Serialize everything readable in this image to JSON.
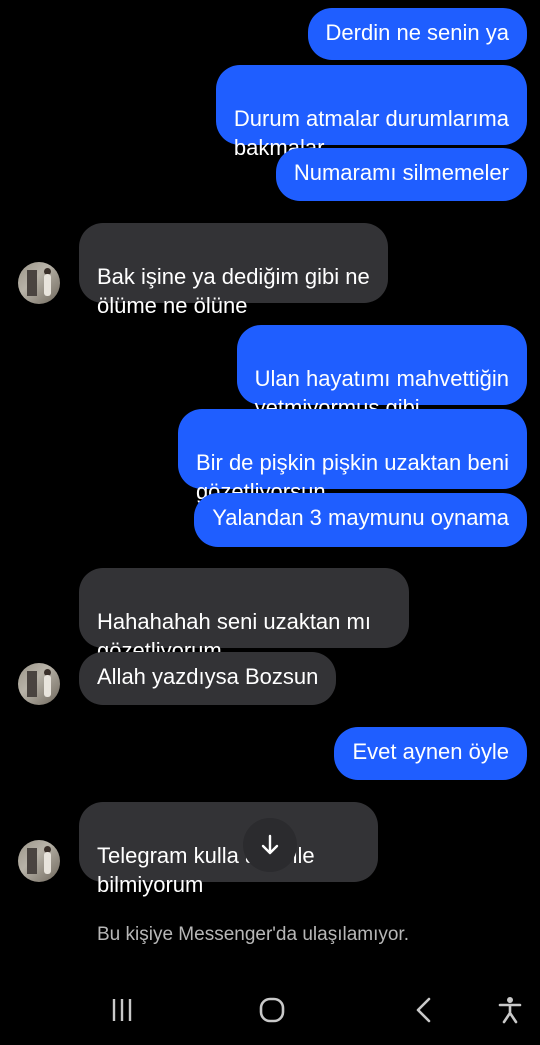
{
  "messages": [
    {
      "text": "Derdin ne senin ya"
    },
    {
      "text": "Durum atmalar durumlarıma\nbakmalar"
    },
    {
      "text": "Numaramı silmemeler"
    },
    {
      "text": "Bak işine ya dediğim gibi ne\nölüme ne ölüne"
    },
    {
      "text": "Ulan hayatımı mahvettiğin\nyetmiyormuş gibi"
    },
    {
      "text": "Bir de pişkin pişkin uzaktan beni\ngözetliyorsun"
    },
    {
      "text": "Yalandan 3 maymunu oynama"
    },
    {
      "text": "Hahahahah seni uzaktan mı\ngözetliyorum"
    },
    {
      "text": "Allah yazdıysa Bozsun"
    },
    {
      "text": "Evet aynen öyle"
    },
    {
      "text": "Telegram kulla  ayı bile\nbilmiyorum"
    }
  ],
  "status_text": "Bu kişiye Messenger'da ulaşılamıyor.",
  "icons": {
    "scroll_down": "arrow-down-icon",
    "nav_recent": "recent-apps-icon",
    "nav_home": "home-icon",
    "nav_back": "back-icon",
    "nav_accessibility": "accessibility-icon"
  },
  "colors": {
    "outgoing_bubble": "#1f5eff",
    "incoming_bubble": "#333336",
    "background": "#000000"
  }
}
